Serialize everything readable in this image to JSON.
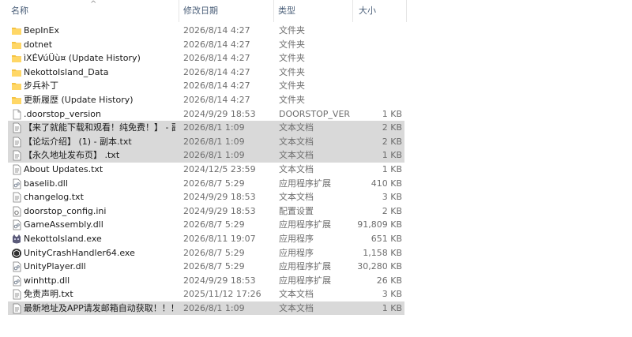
{
  "columns": {
    "name": "名称",
    "date": "修改日期",
    "type": "类型",
    "size": "大小"
  },
  "sort_indicator": "^",
  "files": [
    {
      "name": "BepInEx",
      "date": "2026/8/14 4:27",
      "type": "文件夹",
      "size": "",
      "icon": "folder-icon",
      "selected": false
    },
    {
      "name": "dotnet",
      "date": "2026/8/14 4:27",
      "type": "文件夹",
      "size": "",
      "icon": "folder-icon",
      "selected": false
    },
    {
      "name": "ìXÉVúÜù¤ (Update History)",
      "date": "2026/8/14 4:27",
      "type": "文件夹",
      "size": "",
      "icon": "folder-icon",
      "selected": false
    },
    {
      "name": "NekottoIsland_Data",
      "date": "2026/8/14 4:27",
      "type": "文件夹",
      "size": "",
      "icon": "folder-icon",
      "selected": false
    },
    {
      "name": "步兵补丁",
      "date": "2026/8/14 4:27",
      "type": "文件夹",
      "size": "",
      "icon": "folder-icon",
      "selected": false
    },
    {
      "name": "更新履歴 (Update History)",
      "date": "2026/8/14 4:27",
      "type": "文件夹",
      "size": "",
      "icon": "folder-icon",
      "selected": false
    },
    {
      "name": ".doorstop_version",
      "date": "2024/9/29 18:53",
      "type": "DOORSTOP_VER...",
      "size": "1 KB",
      "icon": "file-icon",
      "selected": false
    },
    {
      "name": "【来了就能下载和观看！纯免费！】 - 副...",
      "date": "2026/8/1 1:09",
      "type": "文本文档",
      "size": "2 KB",
      "icon": "text-file-icon",
      "selected": true
    },
    {
      "name": "【论坛介绍】 (1) - 副本.txt",
      "date": "2026/8/1 1:09",
      "type": "文本文档",
      "size": "2 KB",
      "icon": "text-file-icon",
      "selected": true
    },
    {
      "name": "【永久地址发布页】 .txt",
      "date": "2026/8/1 1:09",
      "type": "文本文档",
      "size": "1 KB",
      "icon": "text-file-icon",
      "selected": true
    },
    {
      "name": "About Updates.txt",
      "date": "2024/12/5 23:59",
      "type": "文本文档",
      "size": "1 KB",
      "icon": "text-file-icon",
      "selected": false
    },
    {
      "name": "baselib.dll",
      "date": "2026/8/7 5:29",
      "type": "应用程序扩展",
      "size": "410 KB",
      "icon": "dll-icon",
      "selected": false
    },
    {
      "name": "changelog.txt",
      "date": "2024/9/29 18:53",
      "type": "文本文档",
      "size": "3 KB",
      "icon": "text-file-icon",
      "selected": false
    },
    {
      "name": "doorstop_config.ini",
      "date": "2024/9/29 18:53",
      "type": "配置设置",
      "size": "2 KB",
      "icon": "settings-file-icon",
      "selected": false
    },
    {
      "name": "GameAssembly.dll",
      "date": "2026/8/7 5:29",
      "type": "应用程序扩展",
      "size": "91,809 KB",
      "icon": "dll-icon",
      "selected": false
    },
    {
      "name": "NekottoIsland.exe",
      "date": "2026/8/11 19:07",
      "type": "应用程序",
      "size": "651 KB",
      "icon": "cat-app-icon",
      "selected": false
    },
    {
      "name": "UnityCrashHandler64.exe",
      "date": "2026/8/7 5:29",
      "type": "应用程序",
      "size": "1,158 KB",
      "icon": "unity-icon",
      "selected": false
    },
    {
      "name": "UnityPlayer.dll",
      "date": "2026/8/7 5:29",
      "type": "应用程序扩展",
      "size": "30,280 KB",
      "icon": "dll-icon",
      "selected": false
    },
    {
      "name": "winhttp.dll",
      "date": "2024/9/29 18:53",
      "type": "应用程序扩展",
      "size": "26 KB",
      "icon": "dll-icon",
      "selected": false
    },
    {
      "name": "免责声明.txt",
      "date": "2025/11/12 17:26",
      "type": "文本文档",
      "size": "3 KB",
      "icon": "text-file-icon",
      "selected": false
    },
    {
      "name": "最新地址及APP请发邮箱自动获取！！！...",
      "date": "2026/8/1 1:09",
      "type": "文本文档",
      "size": "1 KB",
      "icon": "text-file-icon",
      "selected": true
    }
  ]
}
